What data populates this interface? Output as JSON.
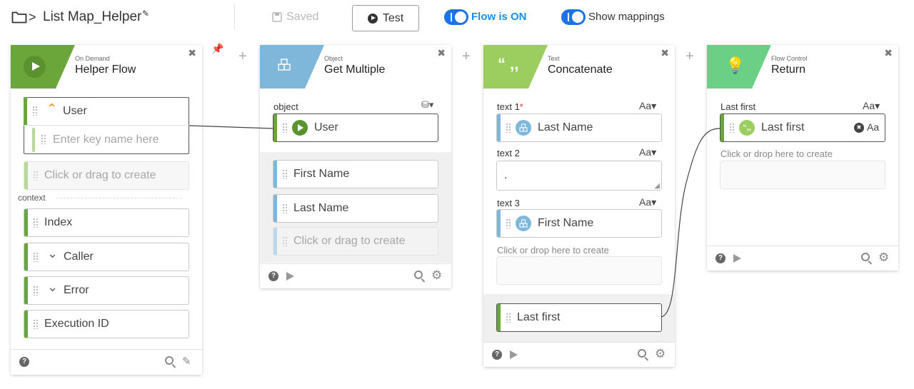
{
  "header": {
    "breadcrumb_sep": ">",
    "flow_title": "List Map_Helper",
    "saved_label": "Saved",
    "test_label": "Test",
    "flow_toggle_label": "Flow is ON",
    "mappings_toggle_label": "Show mappings"
  },
  "cards": {
    "helper": {
      "category": "On Demand",
      "name": "Helper Flow",
      "color": "#6aa63a",
      "user_field": "User",
      "key_placeholder": "Enter key name here",
      "create_placeholder": "Click or drag to create",
      "context_label": "context",
      "context_items": [
        "Index",
        "Caller",
        "Error",
        "Execution ID"
      ]
    },
    "object": {
      "category": "Object",
      "name": "Get Multiple",
      "color": "#7fb7da",
      "object_label": "object",
      "object_value": "User",
      "outputs": [
        "First Name",
        "Last Name"
      ],
      "create_placeholder": "Click or drag to create"
    },
    "text": {
      "category": "Text",
      "name": "Concatenate",
      "color": "#9ccd5f",
      "text1_label": "text 1",
      "required_mark": "*",
      "text1_value": "Last Name",
      "text2_label": "text 2",
      "text2_value": ".",
      "text3_label": "text 3",
      "text3_value": "First Name",
      "drop_hint": "Click or drop here to create",
      "output": "Last first",
      "aa": "Aa"
    },
    "return": {
      "category": "Flow Control",
      "name": "Return",
      "color": "#6ccf86",
      "field_label": "Last first",
      "field_value": "Last first",
      "drop_hint": "Click or drop here to create",
      "aa": "Aa"
    }
  },
  "icons": {
    "play": "▶",
    "close": "✖",
    "gear": "⚙",
    "pencil": "✎",
    "help": "?",
    "caret_up": "⌃",
    "caret_down": "⌄",
    "plus": "+",
    "db": "⛁",
    "clear": "✖"
  }
}
